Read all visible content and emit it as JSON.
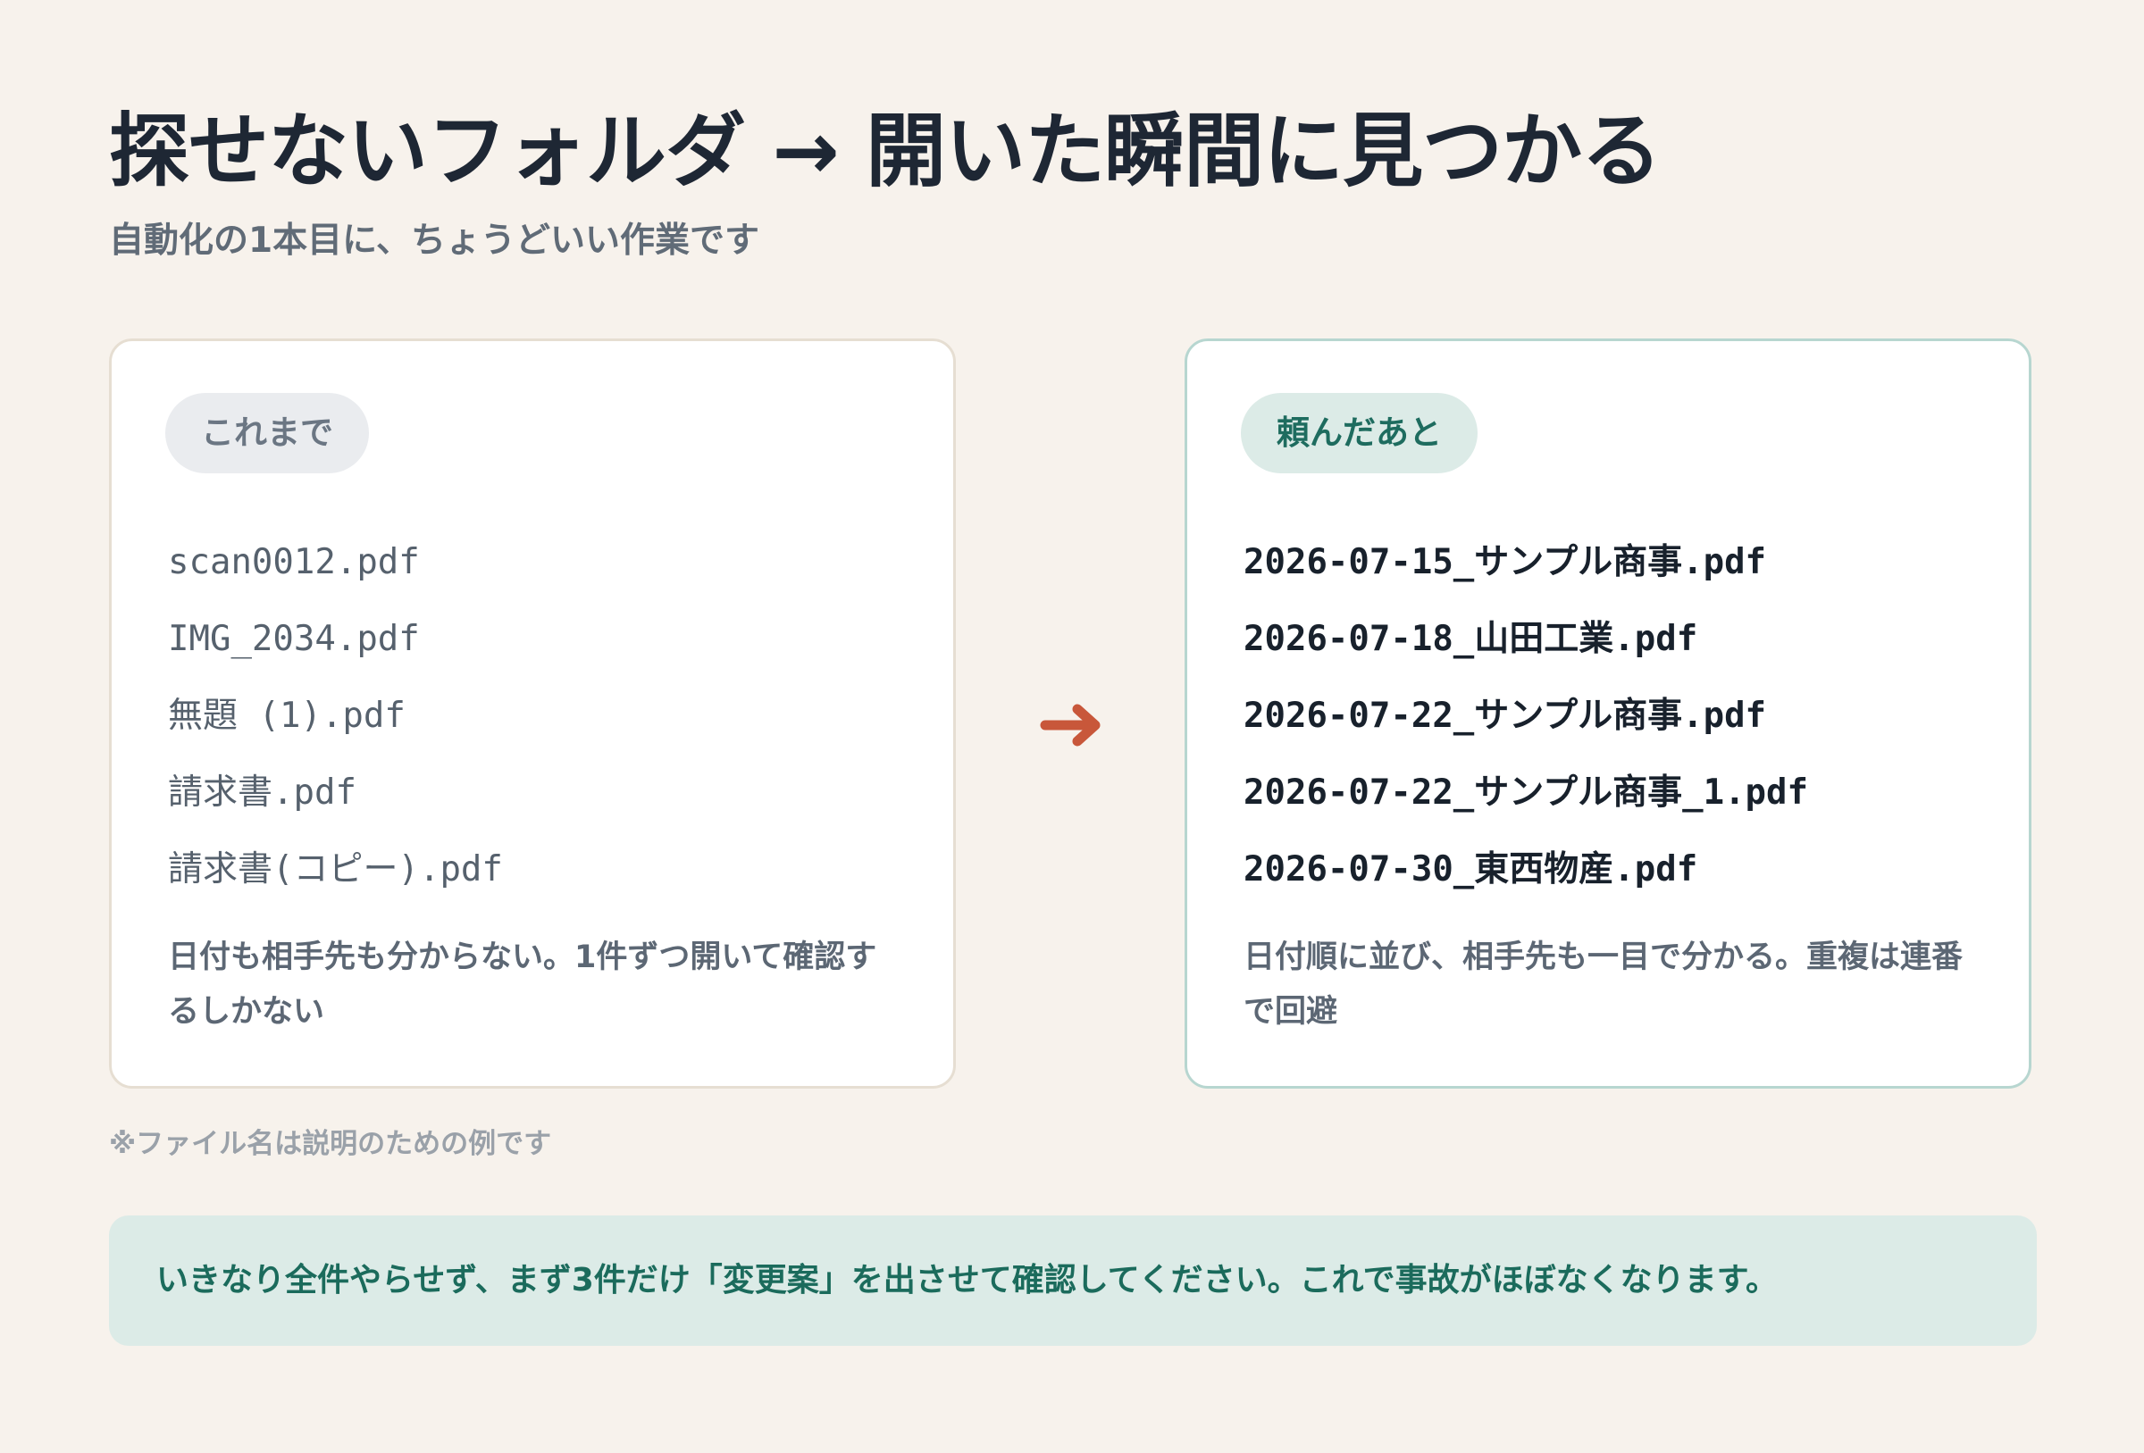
{
  "header": {
    "title": "探せないフォルダ → 開いた瞬間に見つかる",
    "subtitle": "自動化の1本目に、ちょうどいい作業です"
  },
  "before": {
    "badge": "これまで",
    "files": [
      "scan0012.pdf",
      "IMG_2034.pdf",
      "無題 (1).pdf",
      "請求書.pdf",
      "請求書(コピー).pdf"
    ],
    "note": "日付も相手先も分からない。1件ずつ開いて確認するしかない"
  },
  "after": {
    "badge": "頼んだあと",
    "files": [
      "2026-07-15_サンプル商事.pdf",
      "2026-07-18_山田工業.pdf",
      "2026-07-22_サンプル商事.pdf",
      "2026-07-22_サンプル商事_1.pdf",
      "2026-07-30_東西物産.pdf"
    ],
    "note": "日付順に並び、相手先も一目で分かる。重複は連番で回避"
  },
  "arrow_icon": "right-arrow-icon",
  "footnote": "※ファイル名は説明のための例です",
  "tip": "いきなり全件やらせず、まず3件だけ「変更案」を出させて確認してください。これで事故がほぼなくなります。",
  "colors": {
    "background": "#f7f2ec",
    "accent_green": "#1e6c5f",
    "tip_background": "#dcebe7",
    "arrow": "#c8573a",
    "before_border": "#e6ded2",
    "after_border": "#b7d6d0"
  }
}
